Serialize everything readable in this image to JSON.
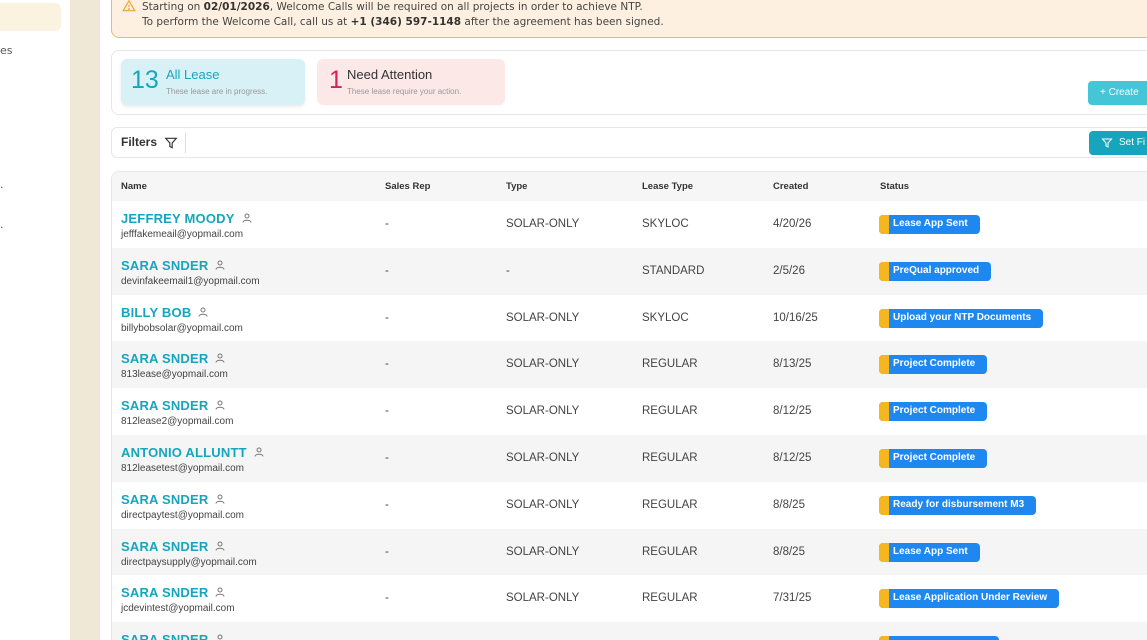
{
  "sidebar": {
    "fragment_1": "es",
    "fragment_2": ".",
    "fragment_3": "."
  },
  "alert": {
    "line1_prefix": "Starting on ",
    "line1_date": "02/01/2026",
    "line1_suffix": ", Welcome Calls will be required on all projects in order to achieve NTP.",
    "line2_prefix": "To perform the Welcome Call, call us at ",
    "line2_phone": "+1 (346) 597-1148",
    "line2_suffix": " after the agreement has been signed."
  },
  "cards": {
    "all": {
      "count": "13",
      "label": "All Lease",
      "sub": "These lease are in progress."
    },
    "attention": {
      "count": "1",
      "label": "Need Attention",
      "sub": "These lease require your action."
    }
  },
  "buttons": {
    "create": "+ Create",
    "set_filters": "Set Fi"
  },
  "filters": {
    "label": "Filters"
  },
  "table": {
    "headers": {
      "name": "Name",
      "sales_rep": "Sales Rep",
      "type": "Type",
      "lease_type": "Lease Type",
      "created": "Created",
      "status": "Status"
    },
    "rows": [
      {
        "name": "JEFFREY MOODY",
        "email": "jefffakemeail@yopmail.com",
        "sales_rep": "-",
        "type": "SOLAR-ONLY",
        "lease_type": "SKYLOC",
        "created": "4/20/26",
        "status": "Lease App Sent"
      },
      {
        "name": "SARA SNDER",
        "email": "devinfakeemail1@yopmail.com",
        "sales_rep": "-",
        "type": "-",
        "lease_type": "STANDARD",
        "created": "2/5/26",
        "status": "PreQual approved"
      },
      {
        "name": "BILLY BOB",
        "email": "billybobsolar@yopmail.com",
        "sales_rep": "-",
        "type": "SOLAR-ONLY",
        "lease_type": "SKYLOC",
        "created": "10/16/25",
        "status": "Upload your NTP Documents"
      },
      {
        "name": "SARA SNDER",
        "email": "813lease@yopmail.com",
        "sales_rep": "-",
        "type": "SOLAR-ONLY",
        "lease_type": "REGULAR",
        "created": "8/13/25",
        "status": "Project Complete"
      },
      {
        "name": "SARA SNDER",
        "email": "812lease2@yopmail.com",
        "sales_rep": "-",
        "type": "SOLAR-ONLY",
        "lease_type": "REGULAR",
        "created": "8/12/25",
        "status": "Project Complete"
      },
      {
        "name": "ANTONIO ALLUNTT",
        "email": "812leasetest@yopmail.com",
        "sales_rep": "-",
        "type": "SOLAR-ONLY",
        "lease_type": "REGULAR",
        "created": "8/12/25",
        "status": "Project Complete"
      },
      {
        "name": "SARA SNDER",
        "email": "directpaytest@yopmail.com",
        "sales_rep": "-",
        "type": "SOLAR-ONLY",
        "lease_type": "REGULAR",
        "created": "8/8/25",
        "status": "Ready for disbursement M3"
      },
      {
        "name": "SARA SNDER",
        "email": "directpaysupply@yopmail.com",
        "sales_rep": "-",
        "type": "SOLAR-ONLY",
        "lease_type": "REGULAR",
        "created": "8/8/25",
        "status": "Lease App Sent"
      },
      {
        "name": "SARA SNDER",
        "email": "jcdevintest@yopmail.com",
        "sales_rep": "-",
        "type": "SOLAR-ONLY",
        "lease_type": "REGULAR",
        "created": "7/31/25",
        "status": "Lease Application Under Review"
      },
      {
        "name": "SARA SNDER",
        "email": "",
        "sales_rep": "",
        "type": "",
        "lease_type": "",
        "created": "",
        "status": ""
      }
    ]
  },
  "colors": {
    "accent": "#17a5be",
    "status_blue": "#1e88f0",
    "status_marker": "#f5b61f",
    "attention": "#d81e5b"
  }
}
